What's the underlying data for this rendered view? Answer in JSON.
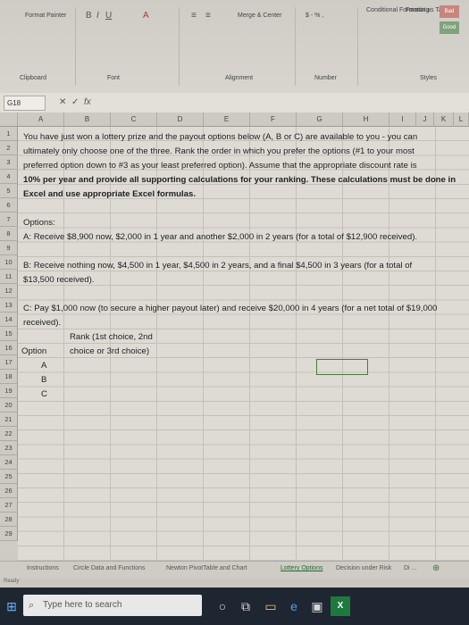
{
  "ribbon": {
    "clipboard": "Clipboard",
    "format_painter": "Format Painter",
    "font": "Font",
    "alignment": "Alignment",
    "merge_center": "Merge & Center",
    "number": "Number",
    "conditional_formatting": "Conditional Formatting",
    "format_as_table": "Format as Table",
    "styles": "Styles",
    "style_bad": "Bad",
    "style_good": "Good",
    "currency": "$ - % ,"
  },
  "formula_bar": {
    "name_box": "G18",
    "cancel": "✕",
    "enter": "✓",
    "fx": "fx",
    "content": ""
  },
  "columns": [
    "A",
    "B",
    "C",
    "D",
    "E",
    "F",
    "G",
    "H",
    "I",
    "J",
    "K",
    "L"
  ],
  "rows": [
    "1",
    "2",
    "3",
    "4",
    "5",
    "6",
    "7",
    "8",
    "9",
    "10",
    "11",
    "12",
    "13",
    "14",
    "15",
    "16",
    "17",
    "18",
    "19",
    "20",
    "21",
    "22",
    "23",
    "24",
    "25",
    "26",
    "27",
    "28",
    "29"
  ],
  "cells": {
    "line1": "You have just won a lottery prize and the payout options below (A, B or C) are available to you - you can",
    "line2": "ultimately only choose one of the three.  Rank the order in which you prefer the options (#1 to your most",
    "line3": "preferred option down to #3 as your least preferred option).  Assume that the appropriate discount rate is",
    "line4": "10% per year and provide all supporting calculations for your ranking. These calculations must be done in",
    "line5": "Excel and use appropriate Excel formulas.",
    "options_header": "Options:",
    "option_a": "A: Receive $8,900 now, $2,000 in 1 year and another $2,000 in 2 years (for a total of $12,900 received).",
    "option_b1": "B: Receive nothing now, $4,500 in 1 year, $4,500 in 2 years, and a final $4,500 in 3 years (for a total of",
    "option_b2": "$13,500 received).",
    "option_c1": "C: Pay $1,000 now (to secure a higher payout later) and receive $20,000 in 4 years (for a net total of $19,000",
    "option_c2": "received).",
    "option_col_header": "Option",
    "rank_header1": "Rank (1st choice, 2nd",
    "rank_header2": "choice or 3rd choice)",
    "opt_a": "A",
    "opt_b": "B",
    "opt_c": "C"
  },
  "sheet_tabs": [
    "Instructions",
    "Circle Data and Functions",
    "Newton PivotTable and Chart",
    "Lottery Options",
    "Decision under Risk",
    "Di ..."
  ],
  "active_tab": "Lottery Options",
  "status": "Ready",
  "taskbar": {
    "search_placeholder": "Type here to search"
  }
}
